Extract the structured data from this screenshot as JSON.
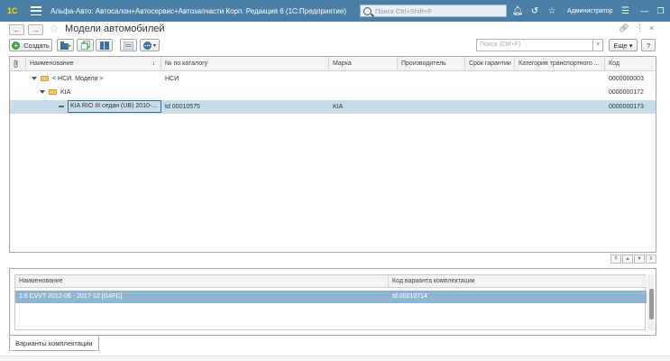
{
  "app": {
    "logo": "1С",
    "title": "Альфа-Авто: Автосалон+Автосервис+Автозапчасти Корп. Редакция 6  (1С:Предприятие)",
    "search_placeholder": "Поиск Ctrl+Shift+F",
    "user": "Администратор"
  },
  "form": {
    "title": "Модели автомобилей",
    "back": "←",
    "forward": "→"
  },
  "toolbar": {
    "create_label": "Создать",
    "search_placeholder": "Поиск (Ctrl+F)",
    "search_clear": "×",
    "more_label": "Еще ▾",
    "help_label": "?"
  },
  "table": {
    "columns": [
      "Наименование",
      "№ по каталогу",
      "Марка",
      "Производитель",
      "Срок гарантии",
      "Категория транспортного ...",
      "Код"
    ],
    "rows": [
      {
        "name": "< НСИ. Модели >",
        "catalog": "НСИ",
        "brand": "",
        "maker": "",
        "warranty": "",
        "category": "",
        "code": "0000000003"
      },
      {
        "name": "KIA",
        "catalog": "",
        "brand": "",
        "maker": "",
        "warranty": "",
        "category": "",
        "code": "0000000172"
      },
      {
        "name": "KIA RIO III седан (UB) 2010-...",
        "catalog": "td 00010575",
        "brand": "KIA",
        "maker": "",
        "warranty": "",
        "category": "",
        "code": "0000000173"
      }
    ]
  },
  "sub_table": {
    "columns": [
      "Наименование",
      "Код варианта комплектации"
    ],
    "rows": [
      {
        "name": "1.6 CVVT 2012-06 - 2017-12 [G4FC]",
        "code": "td 00010714"
      }
    ]
  },
  "tabs": {
    "variants": "Варианты комплектации"
  },
  "colors": {
    "titlebar": "#4a80a7",
    "selection": "#c5dcea",
    "sub_selection": "#8fb6d0",
    "create_icon": "#3aa040"
  }
}
